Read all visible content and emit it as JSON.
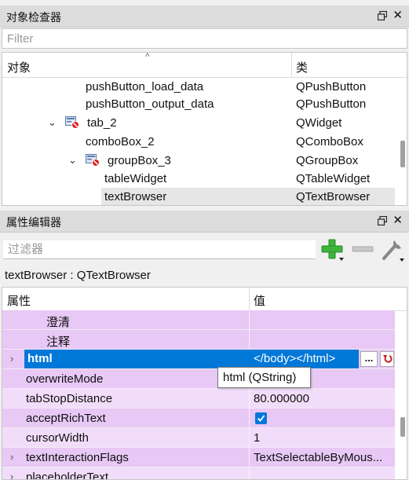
{
  "object_inspector": {
    "title": "对象检查器",
    "filter_placeholder": "Filter",
    "columns": {
      "object": "对象",
      "class": "类"
    },
    "rows": [
      {
        "name": "pushButton_load_data",
        "cls": "QPushButton"
      },
      {
        "name": "pushButton_output_data",
        "cls": "QPushButton"
      },
      {
        "name": "tab_2",
        "cls": "QWidget"
      },
      {
        "name": "comboBox_2",
        "cls": "QComboBox"
      },
      {
        "name": "groupBox_3",
        "cls": "QGroupBox"
      },
      {
        "name": "tableWidget",
        "cls": "QTableWidget"
      },
      {
        "name": "textBrowser",
        "cls": "QTextBrowser"
      }
    ],
    "selected": "textBrowser"
  },
  "property_editor": {
    "title": "属性编辑器",
    "filter_placeholder": "过滤器",
    "object_class_line": "textBrowser : QTextBrowser",
    "columns": {
      "property": "属性",
      "value": "值"
    },
    "rows": [
      {
        "name": "澄清",
        "value": ""
      },
      {
        "name": "注释",
        "value": ""
      },
      {
        "name": "html",
        "value": "</body></html>"
      },
      {
        "name": "overwriteMode",
        "value": ""
      },
      {
        "name": "tabStopDistance",
        "value": "80.000000"
      },
      {
        "name": "acceptRichText",
        "value": "",
        "checked": true
      },
      {
        "name": "cursorWidth",
        "value": "1"
      },
      {
        "name": "textInteractionFlags",
        "value": "TextSelectableByMous..."
      },
      {
        "name": "placeholderText",
        "value": ""
      }
    ],
    "tooltip": "html (QString)",
    "dots_label": "..."
  },
  "colors": {
    "selection": "#0078d7",
    "property_lavender": "#e8c8f5",
    "property_lavender_light": "#f1ddf9",
    "plus_green": "#3cb43c"
  }
}
